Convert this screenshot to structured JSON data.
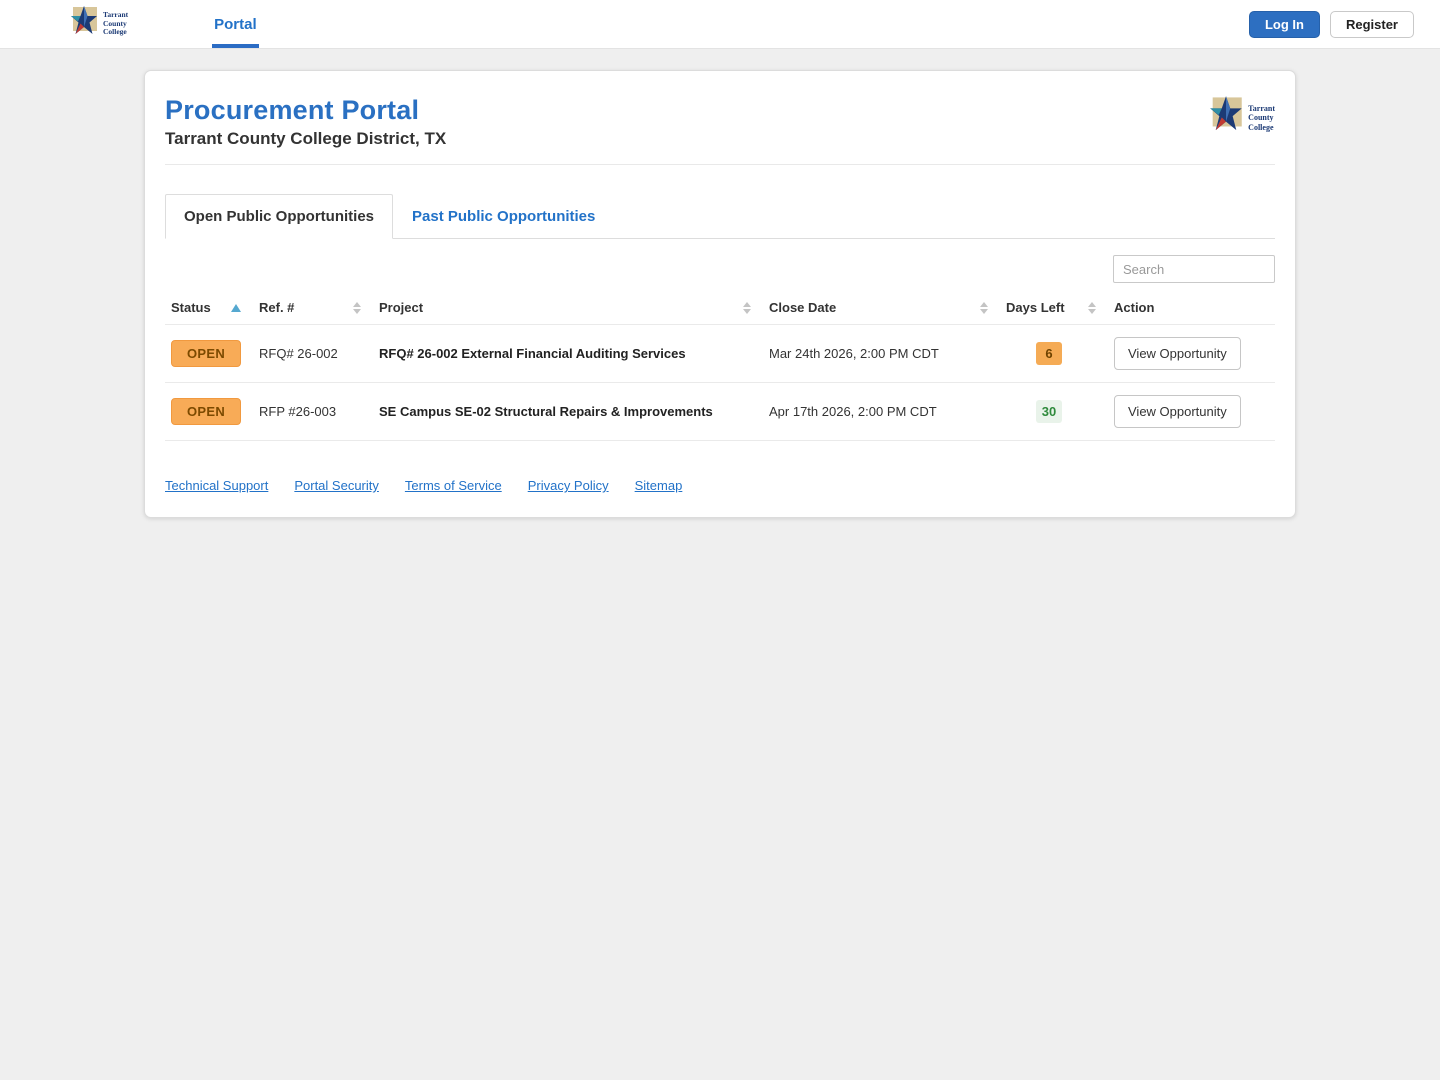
{
  "nav": {
    "brand": {
      "line1": "Tarrant",
      "line2": "County",
      "line3": "College"
    },
    "portal_label": "Portal",
    "login_label": "Log In",
    "register_label": "Register"
  },
  "header": {
    "title": "Procurement Portal",
    "subtitle": "Tarrant County College District, TX"
  },
  "tabs": [
    {
      "label": "Open Public Opportunities",
      "active": true
    },
    {
      "label": "Past Public Opportunities",
      "active": false
    }
  ],
  "search": {
    "placeholder": "Search"
  },
  "table": {
    "columns": [
      "Status",
      "Ref. #",
      "Project",
      "Close Date",
      "Days Left",
      "Action"
    ],
    "sorted_column": "Status",
    "sort_direction": "asc",
    "rows": [
      {
        "status": "OPEN",
        "ref": "RFQ# 26-002",
        "project": "RFQ# 26-002 External Financial Auditing Services",
        "close_date": "Mar 24th 2026, 2:00 PM CDT",
        "days_left": "6",
        "days_left_variant": "warn",
        "action_label": "View Opportunity"
      },
      {
        "status": "OPEN",
        "ref": "RFP #26-003",
        "project": "SE Campus SE-02 Structural Repairs & Improvements",
        "close_date": "Apr 17th 2026, 2:00 PM CDT",
        "days_left": "30",
        "days_left_variant": "ok",
        "action_label": "View Opportunity"
      }
    ]
  },
  "footer": {
    "links": [
      "Technical Support",
      "Portal Security",
      "Terms of Service",
      "Privacy Policy",
      "Sitemap"
    ]
  },
  "colors": {
    "accent_blue": "#2a70c2",
    "open_badge_bg": "#f8ab57",
    "open_badge_text": "#7c4a00",
    "days_warn_bg": "#f5ab55",
    "days_ok_bg": "#e9f3ea",
    "days_ok_text": "#2f8a3c",
    "login_button_bg": "#2d6fc1"
  }
}
